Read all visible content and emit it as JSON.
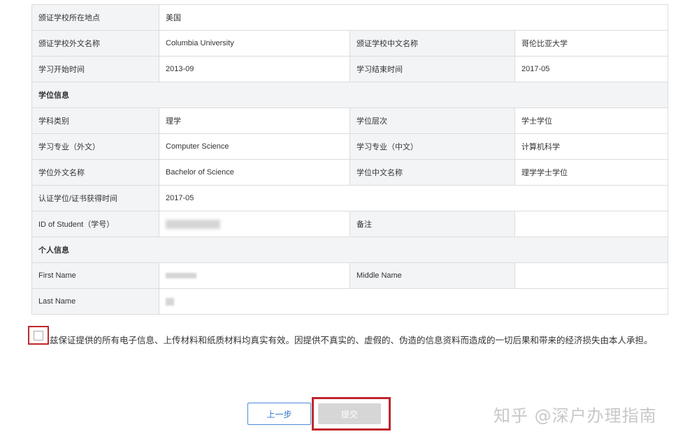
{
  "school": {
    "location_label": "颁证学校所在地点",
    "location_value": "美国",
    "foreign_name_label": "颁证学校外文名称",
    "foreign_name_value": "Columbia University",
    "chinese_name_label": "颁证学校中文名称",
    "chinese_name_value": "哥伦比亚大学",
    "start_label": "学习开始时间",
    "start_value": "2013-09",
    "end_label": "学习结束时间",
    "end_value": "2017-05"
  },
  "degree": {
    "section_title": "学位信息",
    "category_label": "学科类别",
    "category_value": "理学",
    "level_label": "学位层次",
    "level_value": "学士学位",
    "major_foreign_label": "学习专业（外文）",
    "major_foreign_value": "Computer Science",
    "major_chinese_label": "学习专业（中文）",
    "major_chinese_value": "计算机科学",
    "degree_foreign_label": "学位外文名称",
    "degree_foreign_value": "Bachelor of Science",
    "degree_chinese_label": "学位中文名称",
    "degree_chinese_value": "理学学士学位",
    "obtained_label": "认证学位/证书获得时间",
    "obtained_value": "2017-05",
    "student_id_label": "ID of Student（学号）",
    "remarks_label": "备注"
  },
  "personal": {
    "section_title": "个人信息",
    "first_name_label": "First Name",
    "middle_name_label": "Middle Name",
    "last_name_label": "Last Name"
  },
  "declaration": {
    "text": "兹保证提供的所有电子信息、上传材料和纸质材料均真实有效。因提供不真实的、虚假的、伪造的信息资料而造成的一切后果和带来的经济损失由本人承担。",
    "checked": false
  },
  "buttons": {
    "prev_label": "上一步",
    "submit_label": "提交"
  },
  "watermark": "知乎 @深户办理指南",
  "colors": {
    "highlight": "#c0262c",
    "prev_border": "#4a8ed8",
    "submit_disabled": "#d6d6d6"
  }
}
